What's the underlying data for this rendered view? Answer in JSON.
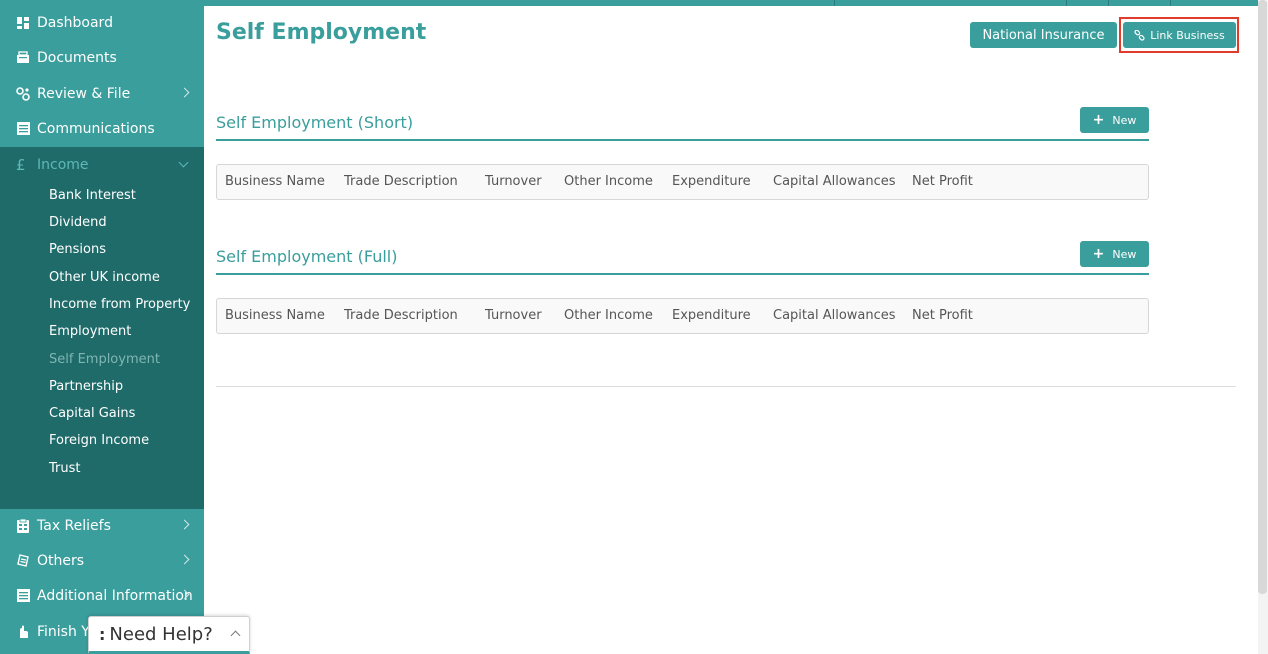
{
  "sidebar": {
    "top_items": [
      {
        "label": "Dashboard",
        "icon": "dashboard-icon"
      },
      {
        "label": "Documents",
        "icon": "documents-icon"
      },
      {
        "label": "Review & File",
        "icon": "review-icon"
      },
      {
        "label": "Communications",
        "icon": "communications-icon"
      }
    ],
    "income": {
      "label": "Income",
      "icon": "pound-icon",
      "items": [
        "Bank Interest",
        "Dividend",
        "Pensions",
        "Other UK income",
        "Income from Property",
        "Employment",
        "Self Employment",
        "Partnership",
        "Capital Gains",
        "Foreign Income",
        "Trust"
      ],
      "active": "Self Employment"
    },
    "bottom_items": [
      {
        "label": "Tax Reliefs",
        "icon": "tax-reliefs-icon"
      },
      {
        "label": "Others",
        "icon": "others-icon"
      },
      {
        "label": "Additional Information",
        "icon": "additional-info-icon"
      },
      {
        "label": "Finish Yo",
        "icon": "finish-icon"
      }
    ]
  },
  "page": {
    "title": "Self Employment",
    "national_insurance_label": "National Insurance",
    "link_business_label": "Link Business"
  },
  "sections": [
    {
      "title": "Self Employment (Short)",
      "new_label": "New"
    },
    {
      "title": "Self Employment (Full)",
      "new_label": "New"
    }
  ],
  "table_columns": [
    "Business Name",
    "Trade Description",
    "Turnover",
    "Other Income",
    "Expenditure",
    "Capital Allowances",
    "Net Profit"
  ],
  "help": {
    "dots": ":",
    "label": "Need Help?"
  },
  "colors": {
    "accent": "#3a9e9c",
    "sidebar_dark": "#1f6b6a",
    "highlight": "#e03b2b"
  }
}
